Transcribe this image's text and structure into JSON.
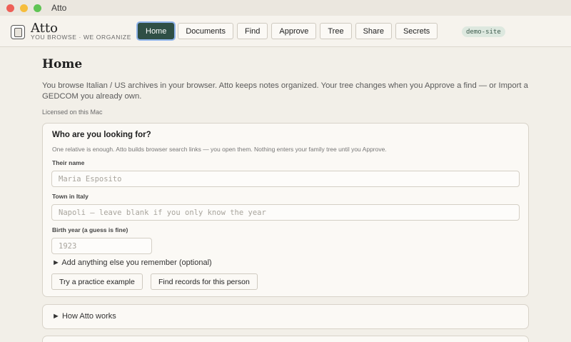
{
  "window": {
    "title": "Atto"
  },
  "brand": {
    "name": "Atto",
    "tagline": "YOU BROWSE · WE ORGANIZE"
  },
  "nav": {
    "items": [
      {
        "label": "Home",
        "active": true
      },
      {
        "label": "Documents"
      },
      {
        "label": "Find"
      },
      {
        "label": "Approve"
      },
      {
        "label": "Tree"
      },
      {
        "label": "Share"
      },
      {
        "label": "Secrets"
      }
    ],
    "site_badge": "demo-site"
  },
  "page": {
    "title": "Home",
    "intro": "You browse Italian / US archives in your browser. Atto keeps notes organized. Your tree changes when you Approve a find — or Import a GEDCOM you already own.",
    "license": "Licensed on this Mac"
  },
  "search_card": {
    "title": "Who are you looking for?",
    "subtitle": "One relative is enough. Atto builds browser search links — you open them. Nothing enters your family tree until you Approve.",
    "name_label": "Their name",
    "name_placeholder": "Maria Esposito",
    "town_label": "Town in Italy",
    "town_placeholder": "Napoli — leave blank if you only know the year",
    "year_label": "Birth year (a guess is fine)",
    "year_placeholder": "1923",
    "more_toggle": "► Add anything else you remember (optional)",
    "practice_button": "Try a practice example",
    "find_button": "Find records for this person"
  },
  "how_card": {
    "toggle": "► How Atto works"
  },
  "colors": {
    "accent": "#2f4f45",
    "background": "#f2efe8",
    "badge_bg": "#dde8df"
  }
}
